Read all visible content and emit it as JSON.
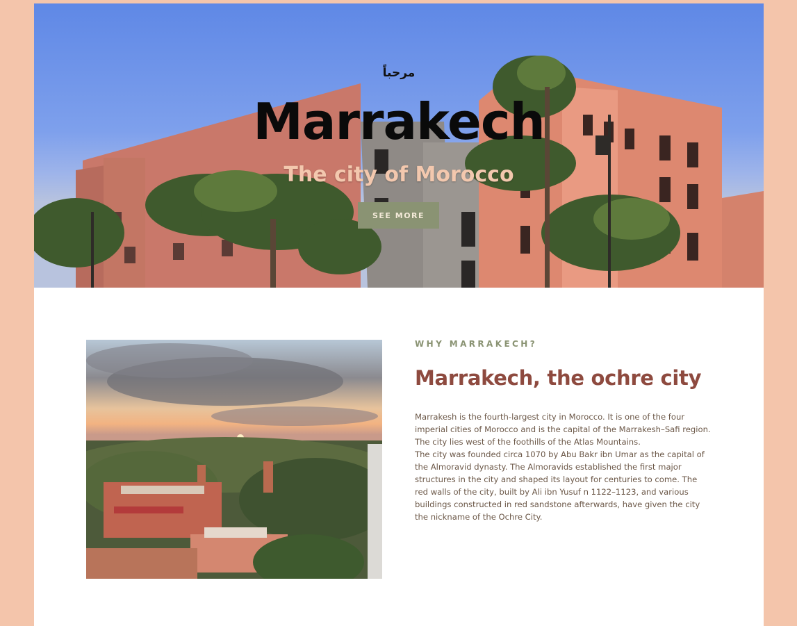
{
  "hero": {
    "greeting": "مرحباً",
    "title": "Marrakech",
    "subtitle": "The city of Morocco",
    "cta_label": "SEE MORE"
  },
  "about": {
    "eyebrow": "WHY MARRAKECH?",
    "title": "Marrakech, the ochre city",
    "paragraphs": [
      "Marrakesh is the fourth-largest city in Morocco. It is one of the four imperial cities of Morocco and is the capital of the Marrakesh–Safi region. The city lies west of the foothills of the Atlas Mountains.",
      "The city was founded circa 1070 by Abu Bakr ibn Umar as the capital of the Almoravid dynasty. The Almoravids established the first major structures in the city and shaped its layout for centuries to come. The red walls of the city, built by Ali ibn Yusuf n 1122–1123, and various buildings constructed in red sandstone afterwards, have given the city the nickname of the Ochre City."
    ]
  },
  "colors": {
    "page_background": "#f4c5ab",
    "accent_green": "#8a9373",
    "title_brown": "#8e4a3f",
    "subtitle_peach": "#f3c8ae"
  }
}
